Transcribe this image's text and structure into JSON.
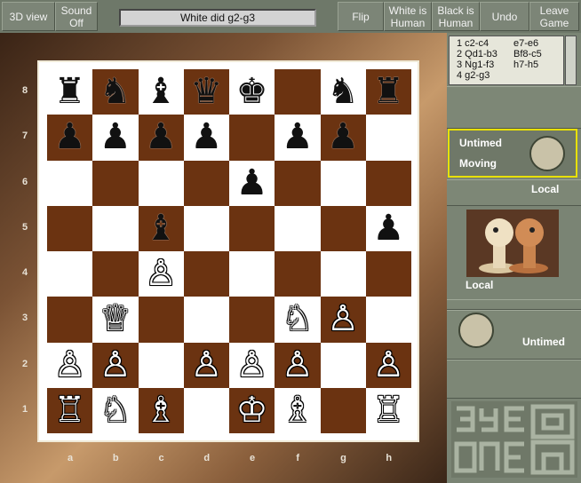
{
  "toolbar": {
    "view_label": "3D view",
    "sound_label": "Sound Off",
    "status": "White did g2-g3",
    "flip_label": "Flip",
    "white_human_label": "White is Human",
    "black_human_label": "Black is Human",
    "undo_label": "Undo",
    "leave_label": "Leave Game"
  },
  "moves": [
    {
      "n": "1",
      "white": "c2-c4",
      "black": "e7-e6"
    },
    {
      "n": "2",
      "white": "Qd1-b3",
      "black": "Bf8-c5"
    },
    {
      "n": "3",
      "white": "Ng1-f3",
      "black": "h7-h5"
    },
    {
      "n": "4",
      "white": "g2-g3",
      "black": ""
    }
  ],
  "black_player": {
    "clock": "Untimed",
    "state": "Moving",
    "type": "Local"
  },
  "white_player": {
    "type": "Local",
    "clock": "Untimed"
  },
  "board": {
    "files": [
      "a",
      "b",
      "c",
      "d",
      "e",
      "f",
      "g",
      "h"
    ],
    "ranks": [
      "8",
      "7",
      "6",
      "5",
      "4",
      "3",
      "2",
      "1"
    ],
    "position": [
      [
        "r",
        "n",
        "b",
        "q",
        "k",
        "",
        "n",
        "r"
      ],
      [
        "p",
        "p",
        "p",
        "p",
        "",
        "p",
        "p",
        ""
      ],
      [
        "",
        "",
        "",
        "",
        "p",
        "",
        "",
        ""
      ],
      [
        "",
        "",
        "b",
        "",
        "",
        "",
        "",
        "p"
      ],
      [
        "",
        "",
        "P",
        "",
        "",
        "",
        "",
        ""
      ],
      [
        "",
        "Q",
        "",
        "",
        "",
        "N",
        "P",
        ""
      ],
      [
        "P",
        "P",
        "",
        "P",
        "P",
        "P",
        "",
        "P"
      ],
      [
        "R",
        "N",
        "B",
        "",
        "K",
        "B",
        "",
        "R"
      ]
    ]
  },
  "icons": {
    "players": "two-pawn-figures-icon",
    "logo": "eye-one-logo"
  },
  "colors": {
    "dark_square": "#6b3311",
    "light_square": "#ffffff",
    "highlight": "#e8e000",
    "panel": "#7d8776"
  }
}
